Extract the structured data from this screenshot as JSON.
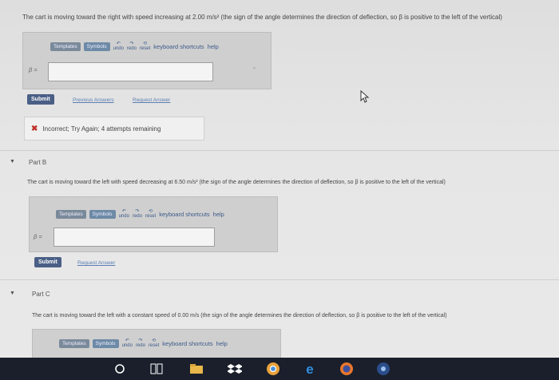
{
  "part_a": {
    "prompt": "The cart is moving toward the right with speed increasing at 2.00 m/s² (the sign of the angle determines the direction of deflection, so β is positive to the left of the vertical)",
    "toolbar": {
      "templates": "Templates",
      "symbols": "Symbols",
      "undo": "undo",
      "redo": "redo",
      "reset": "reset",
      "keyboard": "keyboard shortcuts",
      "help": "help"
    },
    "beta_label": "β =",
    "unit_hint": "°",
    "submit": "Submit",
    "previous_answers": "Previous Answers",
    "request_answer": "Request Answer",
    "feedback": "Incorrect; Try Again; 4 attempts remaining"
  },
  "part_b": {
    "title": "Part B",
    "prompt": "The cart is moving toward the left with speed decreasing at 6.50 m/s² (the sign of the angle determines the direction of deflection, so β is positive to the left of the vertical)",
    "toolbar": {
      "templates": "Templates",
      "symbols": "Symbols",
      "undo": "undo",
      "redo": "redo",
      "reset": "reset",
      "keyboard": "keyboard shortcuts",
      "help": "help"
    },
    "beta_label": "β =",
    "submit": "Submit",
    "request_answer": "Request Answer"
  },
  "part_c": {
    "title": "Part C",
    "prompt": "The cart is moving toward the left with a constant speed of 0.00 m/s (the sign of the angle determines the direction of deflection, so β is positive to the left of the vertical)",
    "toolbar": {
      "templates": "Templates",
      "symbols": "Symbols",
      "undo": "undo",
      "redo": "redo",
      "reset": "reset",
      "keyboard": "keyboard shortcuts",
      "help": "help"
    }
  },
  "taskbar": {
    "icons": [
      "cortana-search-icon",
      "task-view-icon",
      "file-explorer-icon",
      "dropbox-icon",
      "chrome-icon",
      "edge-icon",
      "firefox-icon",
      "media-icon"
    ]
  }
}
